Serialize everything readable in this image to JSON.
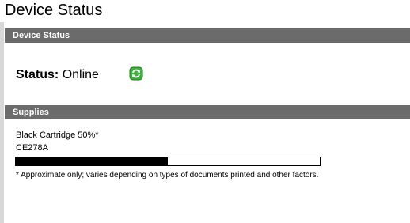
{
  "page": {
    "title": "Device Status"
  },
  "device_status_section": {
    "header": "Device Status",
    "status_label": "Status:",
    "status_value": "Online",
    "refresh_icon": "refresh-icon",
    "refresh_icon_color": "#2e9e2e"
  },
  "supplies_section": {
    "header": "Supplies",
    "cartridge": {
      "name": "Black Cartridge 50%*",
      "part_number": "CE278A",
      "level_percent": 50
    },
    "footnote": "* Approximate only; varies depending on types of documents printed and other factors."
  },
  "colors": {
    "section_bar": "#6b6b6b",
    "section_bar_text": "#ffffff",
    "gauge_fill": "#000000"
  }
}
